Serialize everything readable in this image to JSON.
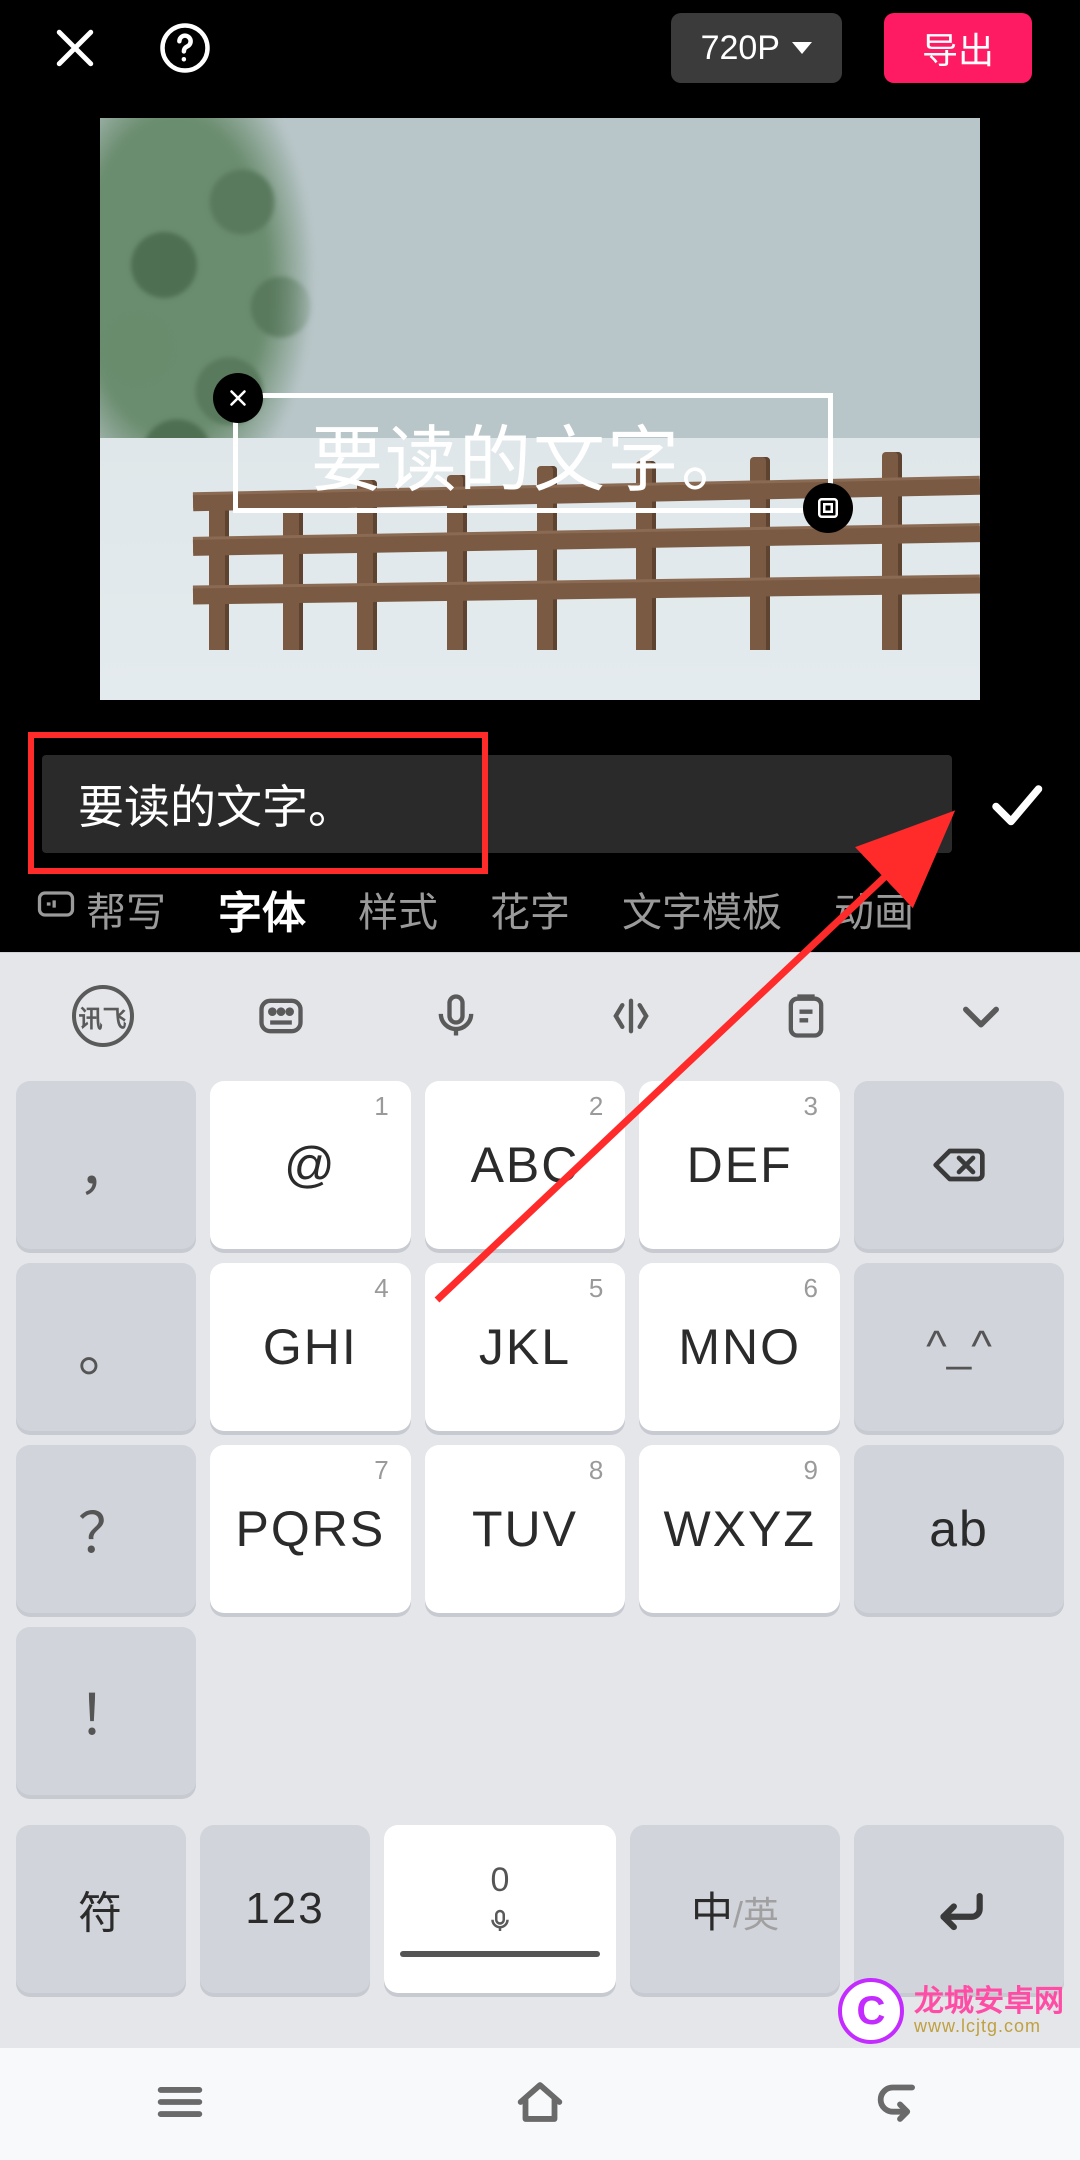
{
  "header": {
    "resolution_label": "720P",
    "export_label": "导出"
  },
  "caption": {
    "text": "要读的文字。"
  },
  "input": {
    "value": "要读的文字。"
  },
  "tabs": {
    "items": [
      {
        "label": "帮写",
        "icon": "ai"
      },
      {
        "label": "字体",
        "active": true
      },
      {
        "label": "样式"
      },
      {
        "label": "花字"
      },
      {
        "label": "文字模板"
      },
      {
        "label": "动画"
      }
    ]
  },
  "keyboard": {
    "brand_label": "讯飞",
    "rows": [
      [
        {
          "sym": "，",
          "side": true
        },
        {
          "sup": "1",
          "main": "@"
        },
        {
          "sup": "2",
          "main": "ABC"
        },
        {
          "sup": "3",
          "main": "DEF"
        },
        {
          "icon": "backspace",
          "side": true
        }
      ],
      [
        {
          "sym": "。",
          "side": true
        },
        {
          "sup": "4",
          "main": "GHI"
        },
        {
          "sup": "5",
          "main": "JKL"
        },
        {
          "sup": "6",
          "main": "MNO"
        },
        {
          "emoticon": "^_^",
          "side": true
        }
      ],
      [
        {
          "sym": "？",
          "side": true
        },
        {
          "sup": "7",
          "main": "PQRS"
        },
        {
          "sup": "8",
          "main": "TUV"
        },
        {
          "sup": "9",
          "main": "WXYZ"
        },
        {
          "main": "ab",
          "side": true
        }
      ],
      [
        {
          "sym": "！",
          "side": true
        }
      ]
    ],
    "bottom": {
      "symbol_label": "符",
      "number_label": "123",
      "space_number": "0",
      "lang_primary": "中",
      "lang_secondary": "/英"
    }
  },
  "watermark": {
    "badge": "C",
    "line1": "龙城安卓网",
    "line2": "www.lcjtg.com"
  }
}
